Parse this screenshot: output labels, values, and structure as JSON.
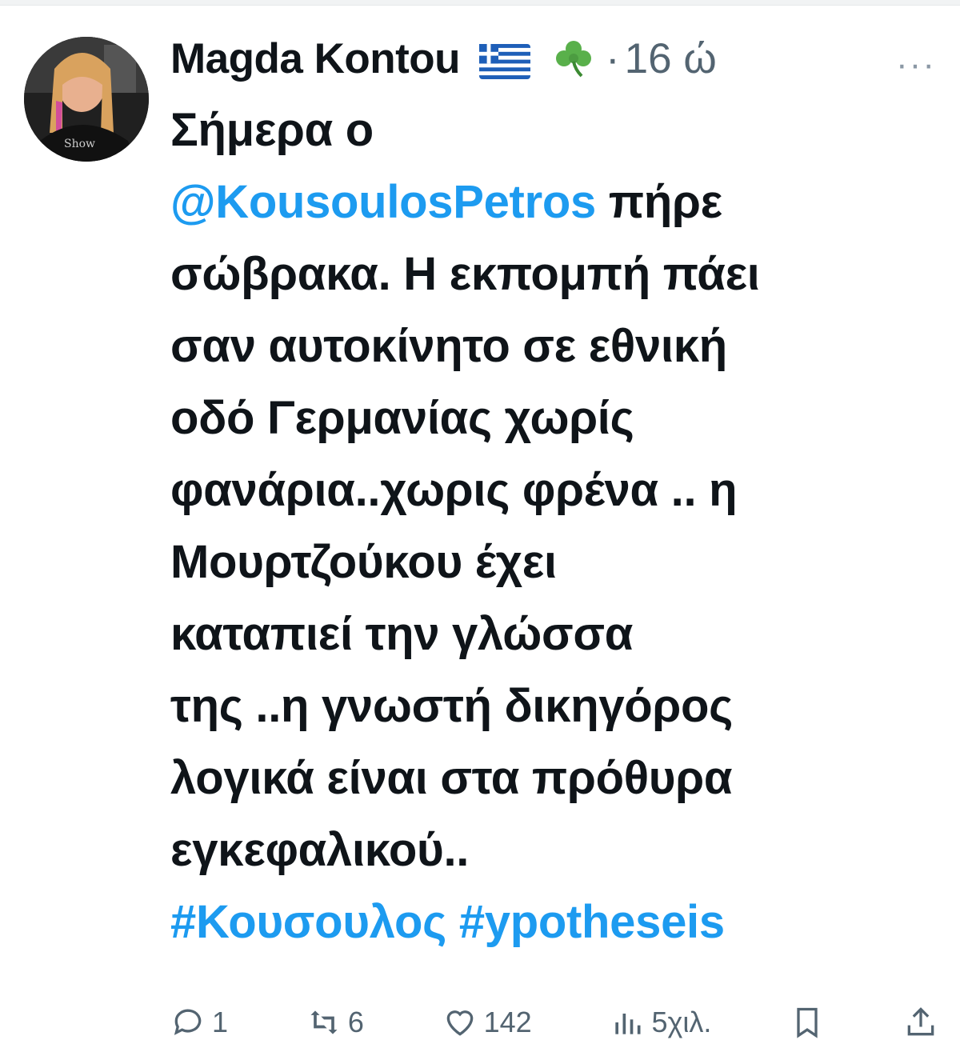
{
  "tweet": {
    "author": "Magda Kontou",
    "flag_icon": "greece-flag-icon",
    "clover_icon": "shamrock-icon",
    "separator": "·",
    "time": "16 ώ",
    "more_label": "···",
    "text_lines": [
      "Σήμερα ο",
      "πήρε",
      "σώβρακα. Η εκπομπή πάει",
      "σαν αυτοκίνητο σε εθνική",
      "οδό Γερμανίας χωρίς",
      "φανάρια..χωρις φρένα .. η",
      "Μουρτζούκου έχει",
      "καταπιεί την γλώσσα",
      "της ..η γνωστή δικηγόρος",
      "λογικά είναι στα πρόθυρα",
      "εγκεφαλικού.."
    ],
    "mention": "@KousoulosPetros",
    "hashtags": [
      "#Κουσουλος",
      "#ypotheseis"
    ]
  },
  "actions": {
    "replies": "1",
    "retweets": "6",
    "likes": "142",
    "views": "5χιλ."
  },
  "colors": {
    "link": "#1d9bf0",
    "muted": "#536471",
    "text": "#0f1419"
  }
}
